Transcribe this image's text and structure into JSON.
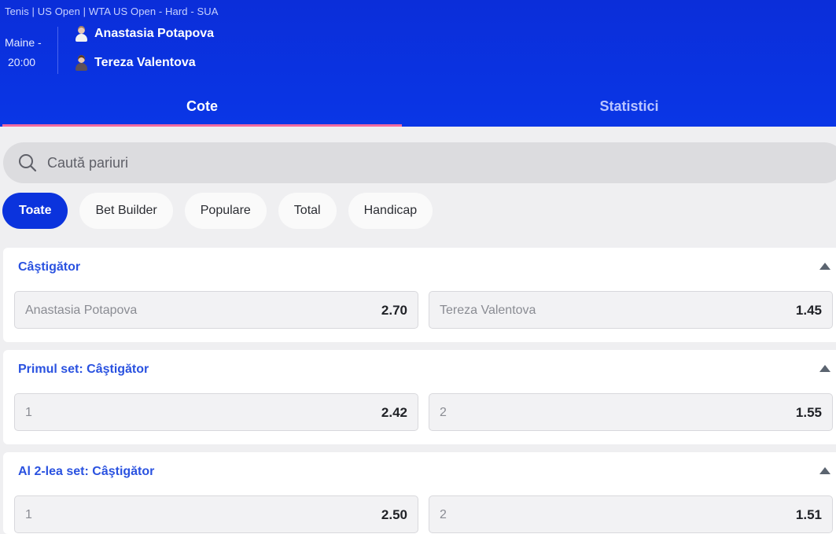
{
  "header": {
    "breadcrumb": "Tenis | US Open | WTA US Open - Hard - SUA",
    "date": "Maine -",
    "time": "20:00",
    "players": [
      "Anastasia Potapova",
      "Tereza Valentova"
    ]
  },
  "tabs": [
    {
      "label": "Cote",
      "active": true
    },
    {
      "label": "Statistici",
      "active": false
    }
  ],
  "search": {
    "placeholder": "Caută pariuri"
  },
  "filters": [
    {
      "label": "Toate",
      "active": true
    },
    {
      "label": "Bet Builder",
      "active": false
    },
    {
      "label": "Populare",
      "active": false
    },
    {
      "label": "Total",
      "active": false
    },
    {
      "label": "Handicap",
      "active": false
    }
  ],
  "markets": [
    {
      "title": "Câştigător",
      "options": [
        {
          "label": "Anastasia Potapova",
          "price": "2.70"
        },
        {
          "label": "Tereza Valentova",
          "price": "1.45"
        }
      ]
    },
    {
      "title": "Primul set: Câştigător",
      "options": [
        {
          "label": "1",
          "price": "2.42"
        },
        {
          "label": "2",
          "price": "1.55"
        }
      ]
    },
    {
      "title": "Al 2-lea set: Câştigător",
      "options": [
        {
          "label": "1",
          "price": "2.50"
        },
        {
          "label": "2",
          "price": "1.51"
        }
      ]
    }
  ],
  "colors": {
    "header_blue": "#0a36e6",
    "active_chip": "#0b33dd",
    "tab_indicator": "#f06aa0",
    "market_title": "#2a52e0"
  }
}
